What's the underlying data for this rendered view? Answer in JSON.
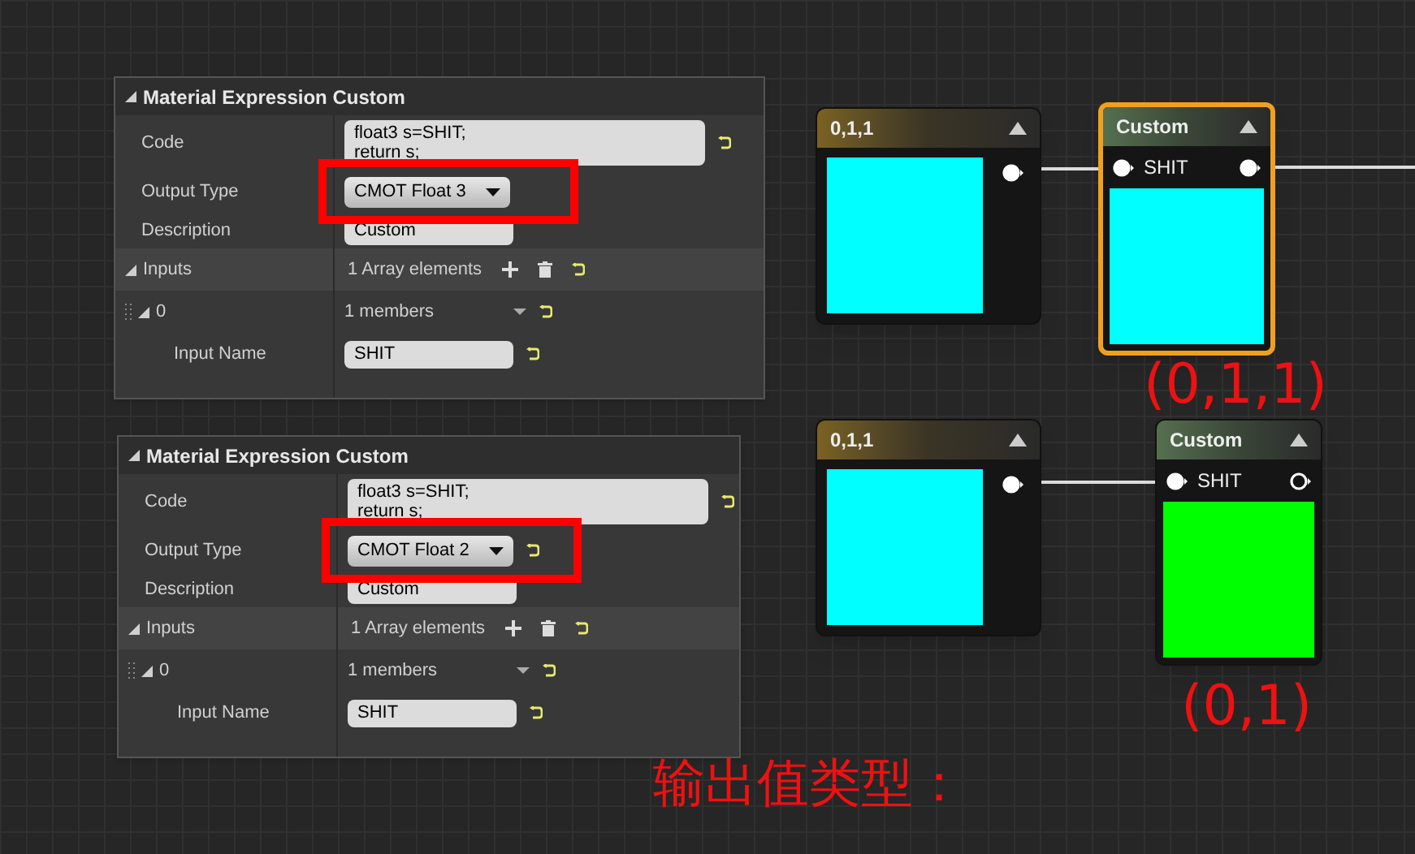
{
  "panels": [
    {
      "title": "Material Expression Custom",
      "code_label": "Code",
      "code": [
        "float3 s=SHIT;",
        "return s;"
      ],
      "output_type_label": "Output Type",
      "output_type": "CMOT Float 3",
      "output_type_modified": false,
      "highlight": true,
      "description_label": "Description",
      "description": "Custom",
      "inputs_label": "Inputs",
      "inputs_value": "1 Array elements",
      "index_label": "0",
      "members": "1 members",
      "input_name_label": "Input Name",
      "input_name": "SHIT"
    },
    {
      "title": "Material Expression Custom",
      "code_label": "Code",
      "code": [
        "float3 s=SHIT;",
        "return s;"
      ],
      "output_type_label": "Output Type",
      "output_type": "CMOT Float 2",
      "output_type_modified": true,
      "highlight": true,
      "description_label": "Description",
      "description": "Custom",
      "inputs_label": "Inputs",
      "inputs_value": "1 Array elements",
      "index_label": "0",
      "members": "1 members",
      "input_name_label": "Input Name",
      "input_name": "SHIT"
    }
  ],
  "nodes": [
    {
      "kind": "constant",
      "title": "0,1,1",
      "color": "#00ffff",
      "selected": false,
      "output_connected": true
    },
    {
      "kind": "custom",
      "title": "Custom",
      "pin": "SHIT",
      "color": "#00ffff",
      "selected": true,
      "output_connected": true
    },
    {
      "kind": "constant",
      "title": "0,1,1",
      "color": "#00ffff",
      "selected": false,
      "output_connected": true
    },
    {
      "kind": "custom",
      "title": "Custom",
      "pin": "SHIT",
      "color": "#00ff00",
      "selected": false,
      "output_connected": false
    }
  ],
  "annotations": [
    {
      "text": "(0,1,1)"
    },
    {
      "text": "(0,1)"
    },
    {
      "text": "输出值类型："
    }
  ]
}
